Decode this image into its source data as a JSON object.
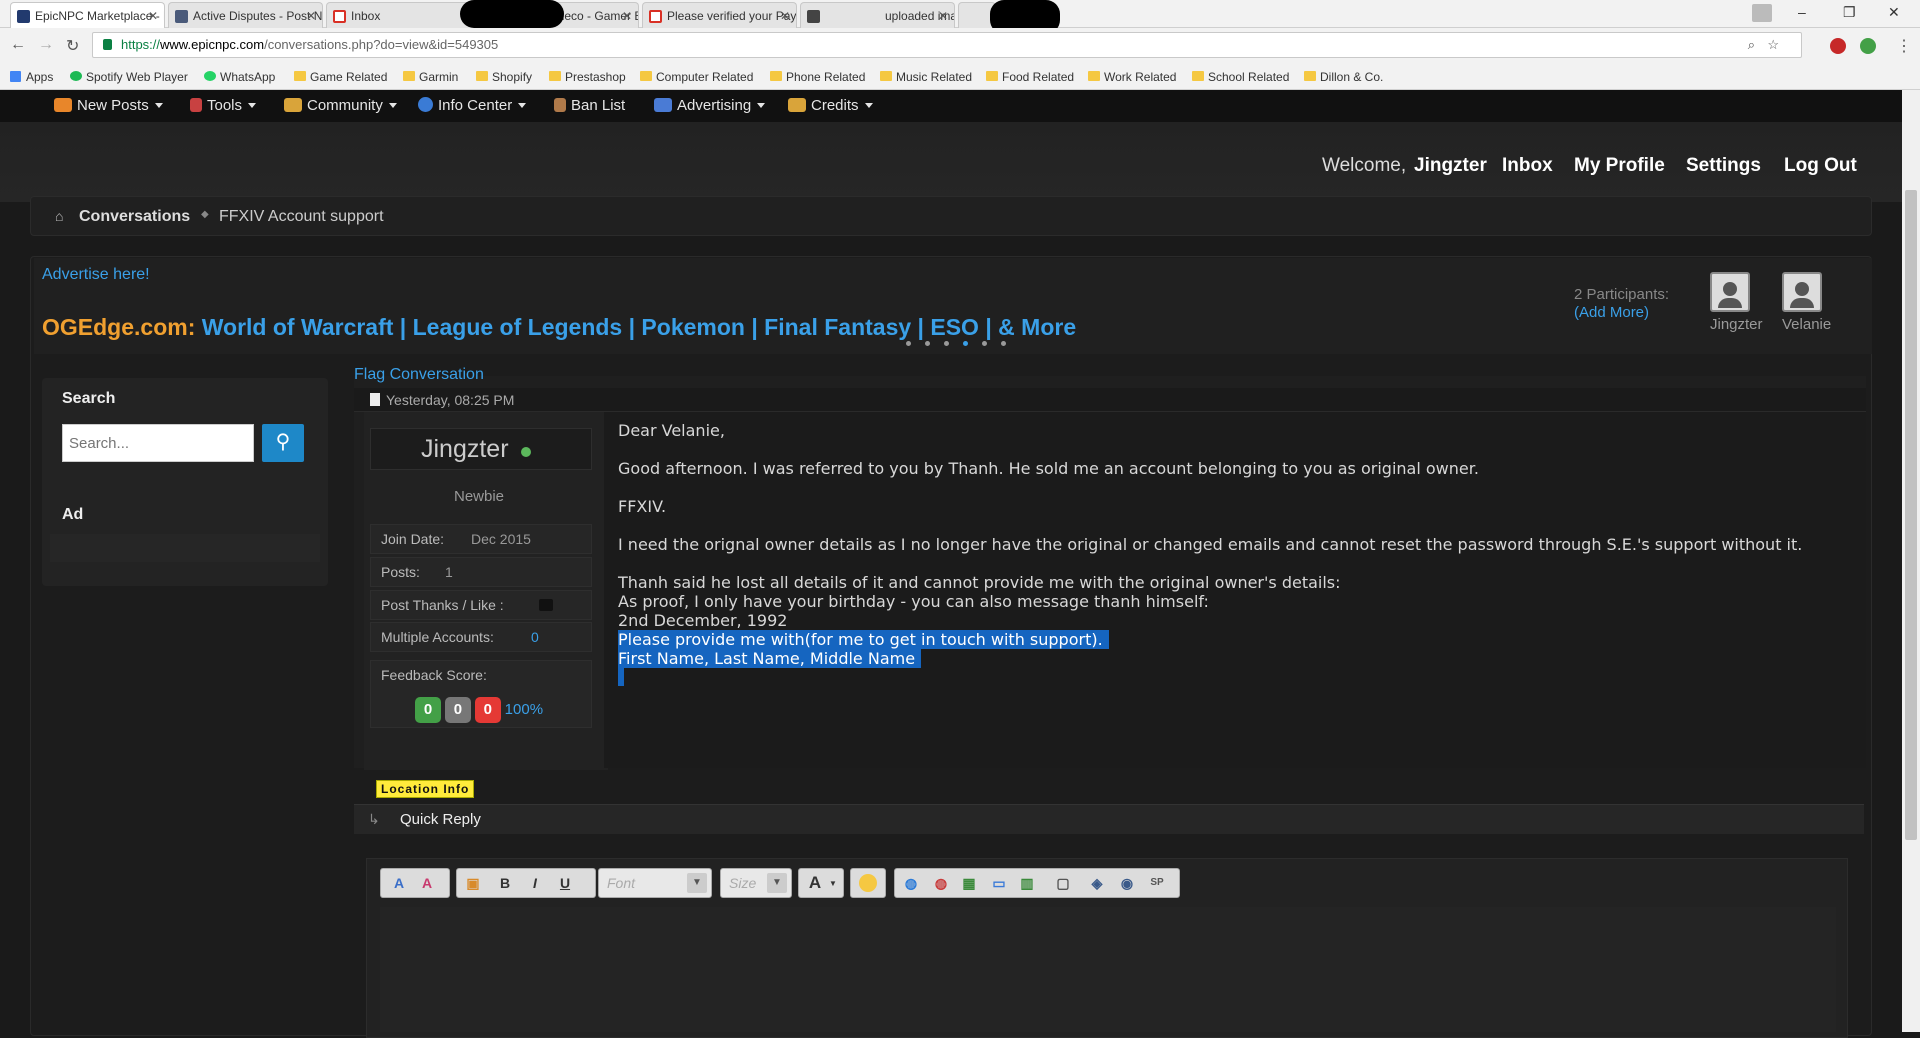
{
  "tabs": [
    {
      "label": "EpicNPC Marketplace - F",
      "active": true,
      "favicon_color": "#223a6e"
    },
    {
      "label": "Active Disputes - Post N",
      "active": false,
      "favicon_color": "#4a5a7a"
    },
    {
      "label": "Inbox",
      "active": false,
      "favicon_color": "#d93025"
    },
    {
      "label": "Spotted Pleco - Gamer E",
      "active": false,
      "favicon_color": "#e53935"
    },
    {
      "label": "Please verified your Pay",
      "active": false,
      "favicon_color": "#d93025"
    },
    {
      "label": "uploaded imag",
      "active": false,
      "favicon_color": "#444444"
    }
  ],
  "address": {
    "protocol": "https://",
    "domain": "www.epicnpc.com",
    "path": "/conversations.php?do=view&id=549305"
  },
  "bookmarks": [
    "Apps",
    "Spotify Web Player",
    "WhatsApp",
    "Game Related",
    "Garmin",
    "Shopify",
    "Prestashop",
    "Computer Related",
    "Phone Related",
    "Music Related",
    "Food Related",
    "Work Related",
    "School Related",
    "Dillon & Co."
  ],
  "forum_nav": [
    {
      "label": "New Posts",
      "icon": "new-icon",
      "color": "#e8862a",
      "caret": true
    },
    {
      "label": "Tools",
      "icon": "rocket-icon",
      "color": "#c84141",
      "caret": true
    },
    {
      "label": "Community",
      "icon": "people-icon",
      "color": "#d9a43a",
      "caret": true
    },
    {
      "label": "Info Center",
      "icon": "info-icon",
      "color": "#3a7bd5",
      "caret": true
    },
    {
      "label": "Ban List",
      "icon": "user-icon",
      "color": "#b07a4a",
      "caret": false
    },
    {
      "label": "Advertising",
      "icon": "chart-icon",
      "color": "#4a7bd5",
      "caret": true
    },
    {
      "label": "Credits",
      "icon": "coins-icon",
      "color": "#d9a43a",
      "caret": true
    }
  ],
  "header": {
    "welcome": "Welcome,",
    "username": "Jingzter",
    "inbox": "Inbox",
    "profile": "My Profile",
    "settings": "Settings",
    "logout": "Log Out"
  },
  "breadcrumb": {
    "root": "Conversations",
    "current": "FFXIV Account support"
  },
  "ad": {
    "advertise": "Advertise here!",
    "brand": "OGEdge.com:",
    "tagline": "World of Warcraft | League of Legends | Pokemon | Final Fantasy | ESO | & More"
  },
  "participants": {
    "count": "2 Participants:",
    "add_more": "(Add More)",
    "names": [
      "Jingzter",
      "Velanie"
    ]
  },
  "sidebar": {
    "search_title": "Search",
    "search_placeholder": "Search...",
    "ad_title": "Ad"
  },
  "post": {
    "flag": "Flag Conversation",
    "timestamp": "Yesterday, 08:25 PM",
    "author": "Jingzter",
    "rank": "Newbie",
    "join_label": "Join Date:",
    "join_value": "Dec 2015",
    "posts_label": "Posts:",
    "posts_value": "1",
    "thanks_label": "Post Thanks / Like :",
    "multi_label": "Multiple Accounts:",
    "multi_value": "0",
    "feedback_label": "Feedback Score:",
    "feedback": {
      "positive": "0",
      "neutral": "0",
      "negative": "0",
      "percent": "100%"
    },
    "location_badge": "Location Info",
    "lines": [
      "Dear Velanie,",
      "Good afternoon. I was referred to you by Thanh. He sold me an account belonging to you as original owner.",
      "FFXIV.",
      "I need the orignal owner details as I no longer have the original or changed emails and cannot reset the password through S.E.'s support without it.",
      "Thanh said he lost all details of it and cannot provide me with the original owner's details:",
      "As proof, I only have your birthday - you can also message thanh himself:",
      "2nd December, 1992",
      "Please provide me with(for me to get in touch with support).",
      "First Name, Last Name, Middle Name"
    ]
  },
  "quick_reply": {
    "title": "Quick Reply",
    "font_placeholder": "Font",
    "size_placeholder": "Size"
  }
}
